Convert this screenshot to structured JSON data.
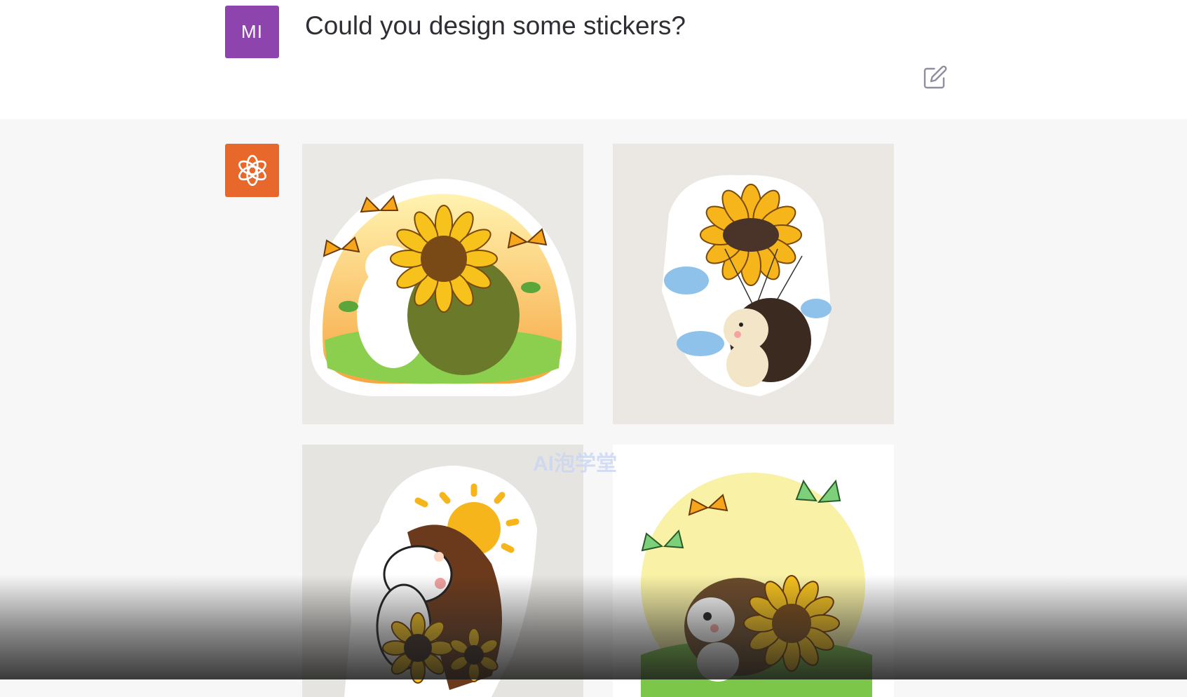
{
  "user": {
    "initials": "MI",
    "message": "Could you design some stickers?",
    "avatar_color": "#8e44ad"
  },
  "assistant": {
    "avatar_icon": "openai-logo-icon",
    "avatar_color": "#e8672a"
  },
  "stickers": [
    {
      "subject": "hedgehog with sunflower and butterflies"
    },
    {
      "subject": "hedgehog parachuting with sunflower"
    },
    {
      "subject": "hedgehog with sun and sunflowers"
    },
    {
      "subject": "hedgehog with sunflower and green butterflies"
    }
  ],
  "watermark": "AI泡学堂",
  "icons": {
    "edit": "edit-icon"
  },
  "colors": {
    "user_row_bg": "#ffffff",
    "assistant_row_bg": "#f7f7f8",
    "text": "#2e2e35"
  }
}
